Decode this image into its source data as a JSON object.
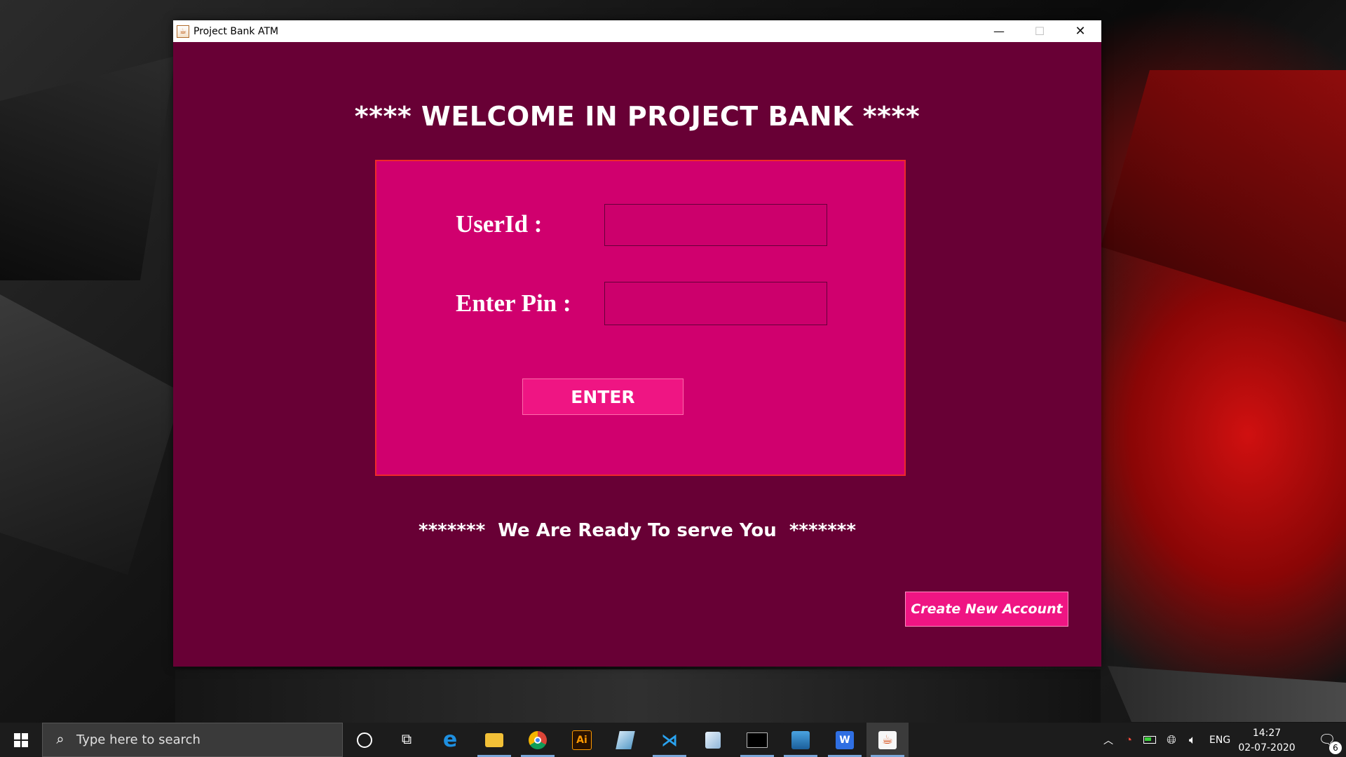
{
  "window": {
    "title": "Project Bank ATM",
    "minimize_icon": "minimize-icon",
    "maximize_icon": "maximize-icon",
    "close_icon": "close-icon",
    "background_color": "#680035"
  },
  "login": {
    "welcome_text": "**** WELCOME IN PROJECT BANK ****",
    "userid_label": "UserId :",
    "userid_value": "",
    "pin_label": "Enter Pin :",
    "pin_value": "",
    "enter_button": "ENTER",
    "ready_text": "*******  We Are Ready To serve You  *******",
    "create_account_button": "Create New Account",
    "panel_color": "#d0006e",
    "button_color": "#ef1583"
  },
  "taskbar": {
    "search_placeholder": "Type here to search",
    "apps": [
      {
        "name": "cortana",
        "icon": "cortana-circle-icon"
      },
      {
        "name": "task-view",
        "icon": "task-view-icon"
      },
      {
        "name": "edge",
        "icon": "edge-icon"
      },
      {
        "name": "file-explorer",
        "icon": "folder-icon"
      },
      {
        "name": "chrome",
        "icon": "chrome-icon"
      },
      {
        "name": "illustrator",
        "icon": "illustrator-icon",
        "label": "Ai"
      },
      {
        "name": "app-prism",
        "icon": "prism-icon"
      },
      {
        "name": "vscode",
        "icon": "vscode-icon"
      },
      {
        "name": "app-cube",
        "icon": "cube-icon"
      },
      {
        "name": "terminal",
        "icon": "terminal-icon"
      },
      {
        "name": "photos",
        "icon": "photos-icon"
      },
      {
        "name": "wps-writer",
        "icon": "wps-icon",
        "label": "W"
      },
      {
        "name": "java",
        "icon": "java-icon"
      }
    ],
    "language": "ENG",
    "time": "14:27",
    "date": "02-07-2020",
    "notification_count": "6"
  }
}
